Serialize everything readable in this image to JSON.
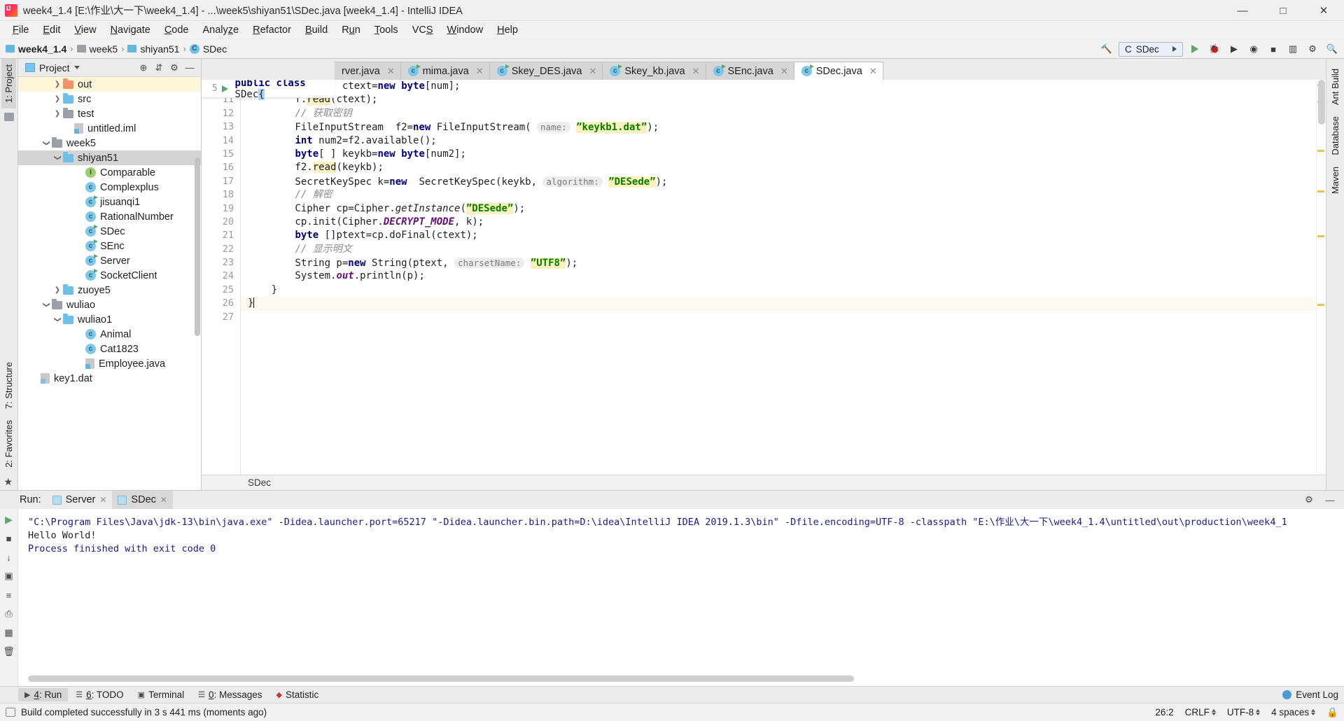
{
  "window": {
    "title": "week4_1.4 [E:\\作业\\大一下\\week4_1.4] - ...\\week5\\shiyan51\\SDec.java [week4_1.4] - IntelliJ IDEA",
    "app_icon": "intellij-idea-icon",
    "minimize": "—",
    "maximize": "□",
    "close": "✕"
  },
  "menubar": {
    "items": [
      {
        "label": "File"
      },
      {
        "label": "Edit"
      },
      {
        "label": "View"
      },
      {
        "label": "Navigate"
      },
      {
        "label": "Code"
      },
      {
        "label": "Analyze"
      },
      {
        "label": "Refactor"
      },
      {
        "label": "Build"
      },
      {
        "label": "Run"
      },
      {
        "label": "Tools"
      },
      {
        "label": "VCS"
      },
      {
        "label": "Window"
      },
      {
        "label": "Help"
      }
    ]
  },
  "navbar": {
    "breadcrumbs": [
      {
        "label": "week4_1.4",
        "icon": "module-icon"
      },
      {
        "label": "week5",
        "icon": "folder-icon"
      },
      {
        "label": "shiyan51",
        "icon": "folder-icon"
      },
      {
        "label": "SDec",
        "icon": "java-class-icon"
      }
    ],
    "separator": "›",
    "run_config": "SDec",
    "icons": [
      "hammer-build-icon",
      "run-icon",
      "debug-icon",
      "run-coverage-icon",
      "profile-icon",
      "stop-icon",
      "layout-icon",
      "settings-icon",
      "search-icon"
    ]
  },
  "left_strip": {
    "project_tab": "1: Project",
    "structure_tab": "7: Structure",
    "favorites_tab": "2: Favorites",
    "favorites_icon": "star-icon",
    "pin_icon": "pin-icon"
  },
  "right_strip": {
    "ant_build": "Ant Build",
    "database": "Database",
    "maven": "Maven"
  },
  "project_panel": {
    "title": "Project",
    "caret": "▾",
    "header_icons": [
      "target-locate-icon",
      "collapse-all-icon",
      "gear-icon",
      "hide-icon"
    ],
    "tree": [
      {
        "label": "out",
        "indent": 3,
        "arrow": "right",
        "icon": "folder-orange",
        "state": "highlight-yellow"
      },
      {
        "label": "src",
        "indent": 3,
        "arrow": "right",
        "icon": "folder-blue",
        "state": "none"
      },
      {
        "label": "test",
        "indent": 3,
        "arrow": "right",
        "icon": "folder-gray",
        "state": "none"
      },
      {
        "label": "untitled.iml",
        "indent": 4,
        "arrow": "none",
        "icon": "file-iml",
        "state": "none"
      },
      {
        "label": "week5",
        "indent": 2,
        "arrow": "down",
        "icon": "folder-gray",
        "state": "none"
      },
      {
        "label": "shiyan51",
        "indent": 3,
        "arrow": "down",
        "icon": "folder-blue",
        "state": "selected-gray"
      },
      {
        "label": "Comparable",
        "indent": 5,
        "arrow": "none",
        "icon": "interface-icon",
        "state": "none"
      },
      {
        "label": "Complexplus",
        "indent": 5,
        "arrow": "none",
        "icon": "class-icon",
        "state": "none"
      },
      {
        "label": "jisuanqi1",
        "indent": 5,
        "arrow": "none",
        "icon": "class-runnable-icon",
        "state": "none"
      },
      {
        "label": "RationalNumber",
        "indent": 5,
        "arrow": "none",
        "icon": "class-icon",
        "state": "none"
      },
      {
        "label": "SDec",
        "indent": 5,
        "arrow": "none",
        "icon": "class-runnable-icon",
        "state": "none"
      },
      {
        "label": "SEnc",
        "indent": 5,
        "arrow": "none",
        "icon": "class-runnable-icon",
        "state": "none"
      },
      {
        "label": "Server",
        "indent": 5,
        "arrow": "none",
        "icon": "class-runnable-icon",
        "state": "none"
      },
      {
        "label": "SocketClient",
        "indent": 5,
        "arrow": "none",
        "icon": "class-runnable-icon",
        "state": "none"
      },
      {
        "label": "zuoye5",
        "indent": 3,
        "arrow": "right",
        "icon": "folder-blue",
        "state": "none"
      },
      {
        "label": "wuliao",
        "indent": 2,
        "arrow": "down",
        "icon": "folder-gray",
        "state": "none"
      },
      {
        "label": "wuliao1",
        "indent": 3,
        "arrow": "down",
        "icon": "folder-blue",
        "state": "none"
      },
      {
        "label": "Animal",
        "indent": 5,
        "arrow": "none",
        "icon": "class-icon",
        "state": "none"
      },
      {
        "label": "Cat1823",
        "indent": 5,
        "arrow": "none",
        "icon": "class-icon",
        "state": "none"
      },
      {
        "label": "Employee.java",
        "indent": 5,
        "arrow": "none",
        "icon": "file-java",
        "state": "none"
      },
      {
        "label": "key1.dat",
        "indent": 1,
        "arrow": "none",
        "icon": "file-unknown",
        "state": "none"
      }
    ]
  },
  "editor": {
    "tabs": [
      {
        "label": "rver.java",
        "icon": "java-class-icon",
        "active": false,
        "close": "✕"
      },
      {
        "label": "mima.java",
        "icon": "java-class-icon",
        "active": false,
        "close": "✕"
      },
      {
        "label": "Skey_DES.java",
        "icon": "java-class-icon",
        "active": false,
        "close": "✕"
      },
      {
        "label": "Skey_kb.java",
        "icon": "java-class-icon",
        "active": false,
        "close": "✕"
      },
      {
        "label": "SEnc.java",
        "icon": "java-class-icon",
        "active": false,
        "close": "✕"
      },
      {
        "label": "SDec.java",
        "icon": "java-class-icon",
        "active": true,
        "close": "✕"
      }
    ],
    "sticky_header": {
      "line_number": "5",
      "text": "public class SDec{",
      "run_icon": "run-gutter-icon"
    },
    "breadcrumb": "SDec",
    "first_line": 10,
    "lines": [
      {
        "n": 10,
        "text": "byte[ ] ctext=new byte[num];"
      },
      {
        "n": 11,
        "text": "f.read(ctext);"
      },
      {
        "n": 12,
        "text": "// 获取密钥"
      },
      {
        "n": 13,
        "text": "FileInputStream  f2=new FileInputStream( name: \"keykb1.dat\");"
      },
      {
        "n": 14,
        "text": "int num2=f2.available();"
      },
      {
        "n": 15,
        "text": "byte[ ] keykb=new byte[num2];"
      },
      {
        "n": 16,
        "text": "f2.read(keykb);"
      },
      {
        "n": 17,
        "text": "SecretKeySpec k=new  SecretKeySpec(keykb, algorithm: \"DESede\");"
      },
      {
        "n": 18,
        "text": "// 解密"
      },
      {
        "n": 19,
        "text": "Cipher cp=Cipher.getInstance(\"DESede\");"
      },
      {
        "n": 20,
        "text": "cp.init(Cipher.DECRYPT_MODE, k);"
      },
      {
        "n": 21,
        "text": "byte []ptext=cp.doFinal(ctext);"
      },
      {
        "n": 22,
        "text": "// 显示明文"
      },
      {
        "n": 23,
        "text": "String p=new String(ptext, charsetName: \"UTF8\");"
      },
      {
        "n": 24,
        "text": "System.out.println(p);"
      },
      {
        "n": 25,
        "text": "}"
      },
      {
        "n": 26,
        "text": "}"
      },
      {
        "n": 27,
        "text": ""
      }
    ],
    "hint_params": {
      "name": "name:",
      "algorithm": "algorithm:",
      "charsetName": "charsetName:"
    }
  },
  "run_panel": {
    "label": "Run:",
    "tabs": [
      {
        "label": "Server",
        "active": false,
        "close": "✕"
      },
      {
        "label": "SDec",
        "active": true,
        "close": "✕"
      }
    ],
    "header_icons": [
      "gear-icon",
      "hide-icon"
    ],
    "side_icons": [
      "rerun-icon",
      "stop-icon",
      "camera-icon",
      "scroll-down-icon",
      "print-icon",
      "soft-wrap-icon",
      "grid-icon",
      "trash-icon"
    ],
    "console": [
      "\"C:\\Program Files\\Java\\jdk-13\\bin\\java.exe\" -Didea.launcher.port=65217 \"-Didea.launcher.bin.path=D:\\idea\\IntelliJ IDEA 2019.1.3\\bin\" -Dfile.encoding=UTF-8 -classpath \"E:\\作业\\大一下\\week4_1.4\\untitled\\out\\production\\week4_1",
      "Hello World!",
      "",
      "Process finished with exit code 0"
    ]
  },
  "bottom_tabs": {
    "items": [
      {
        "num": "4",
        "label": ": Run",
        "icon": "run-icon",
        "active": true
      },
      {
        "num": "6",
        "label": ": TODO",
        "icon": "todo-icon",
        "active": false
      },
      {
        "num": "",
        "label": "Terminal",
        "icon": "terminal-icon",
        "active": false
      },
      {
        "num": "0",
        "label": ": Messages",
        "icon": "messages-icon",
        "active": false
      },
      {
        "num": "",
        "label": "Statistic",
        "icon": "statistic-icon",
        "active": false
      }
    ],
    "event_log": "Event Log",
    "event_log_icon": "event-log-icon"
  },
  "statusbar": {
    "message": "Build completed successfully in 3 s 441 ms (moments ago)",
    "left_icon": "minimize-all-icon",
    "position": "26:2",
    "line_sep": "CRLF",
    "encoding": "UTF-8",
    "indent": "4 spaces",
    "lock_icon": "lock-icon"
  }
}
